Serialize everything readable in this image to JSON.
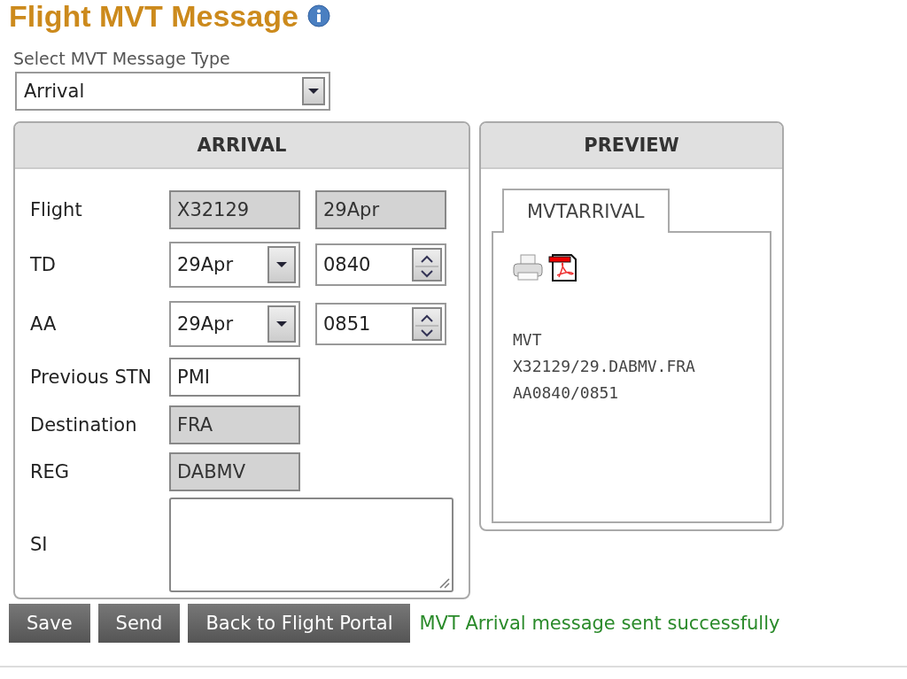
{
  "title": "Flight MVT Message",
  "type_select": {
    "label": "Select MVT Message Type",
    "value": "Arrival"
  },
  "form_panel": {
    "title": "ARRIVAL",
    "rows": [
      {
        "kind": "readonly_pair",
        "label": "Flight",
        "values": [
          "X32129",
          "29Apr"
        ]
      },
      {
        "kind": "datetime",
        "label": "TD",
        "date": "29Apr",
        "time": "0840"
      },
      {
        "kind": "datetime",
        "label": "AA",
        "date": "29Apr",
        "time": "0851"
      },
      {
        "kind": "text",
        "label": "Previous STN",
        "value": "PMI"
      },
      {
        "kind": "readonly",
        "label": "Destination",
        "value": "FRA"
      },
      {
        "kind": "readonly",
        "label": "REG",
        "value": "DABMV"
      },
      {
        "kind": "textarea",
        "label": "SI"
      }
    ]
  },
  "preview_panel": {
    "title": "PREVIEW",
    "tabs": [
      {
        "label": "MVTARRIVAL",
        "selected": true
      }
    ],
    "message_lines": [
      "MVT",
      "X32129/29.DABMV.FRA",
      "AA0840/0851"
    ]
  },
  "buttons": [
    "Save",
    "Send",
    "Back to Flight Portal"
  ],
  "status_message": "MVT Arrival message sent successfully"
}
